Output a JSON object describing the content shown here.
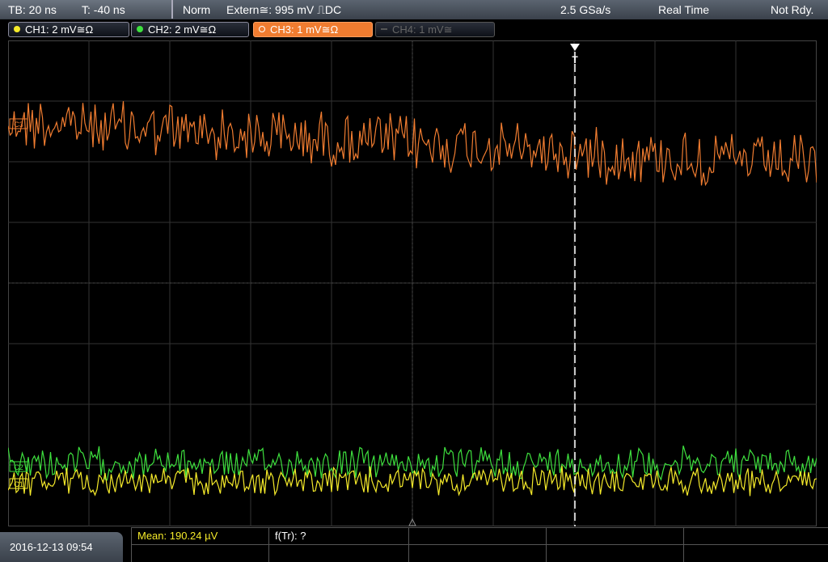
{
  "header": {
    "timebase": "TB: 20 ns",
    "trigger_time": "T: -40 ns",
    "trigger_mode": "Norm",
    "trigger_source": "Extern≅: 995 mV ⎍DC",
    "sample_rate": "2.5 GSa/s",
    "acq_mode": "Real Time",
    "status": "Not Rdy."
  },
  "channels": [
    {
      "label": "CH1: 2 mV≅Ω",
      "color": "#f5ea2a",
      "state": "on"
    },
    {
      "label": "CH2: 2 mV≅Ω",
      "color": "#3ee03e",
      "state": "on"
    },
    {
      "label": "CH3: 1 mV≅Ω",
      "color": "#f07c30",
      "state": "active"
    },
    {
      "label": "CH4: 1 mV≅",
      "color": "#666666",
      "state": "off"
    }
  ],
  "markers": {
    "trigger": "T",
    "ch3": "C3",
    "ch2": "C2",
    "ch1": "C1"
  },
  "footer": {
    "datetime": "2016-12-13 09:54",
    "mean": "Mean: 190.24 µV",
    "frequency": "f(Tr): ?"
  },
  "colors": {
    "ch1": "#f5ea2a",
    "ch2": "#3ee03e",
    "ch3": "#f07c30",
    "grid": "#3a3a3a"
  }
}
